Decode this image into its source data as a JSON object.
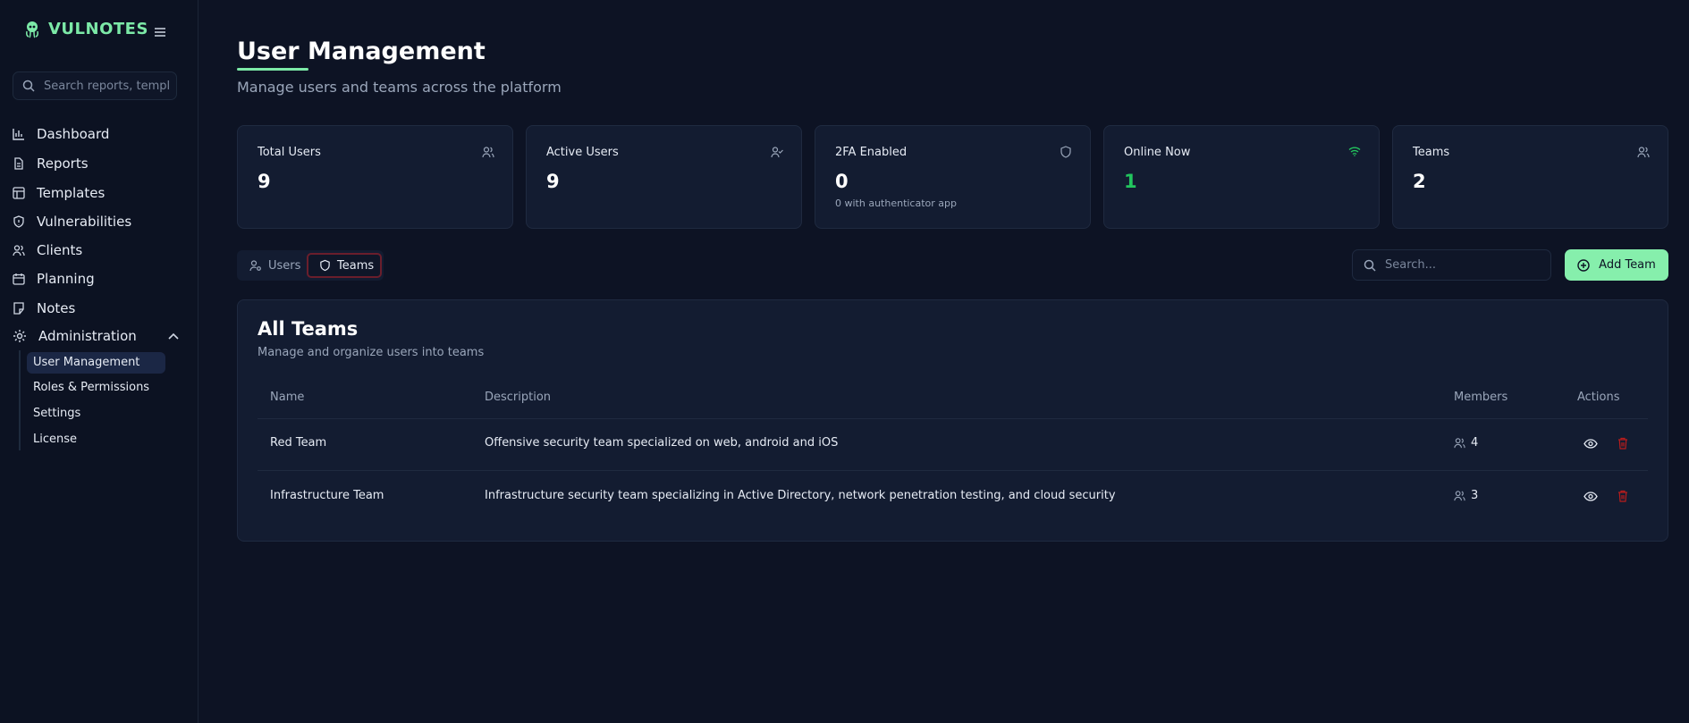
{
  "brand": {
    "name": "VULNOTES",
    "accent": "#7ce9a7"
  },
  "sidebar": {
    "search_placeholder": "Search reports, templates...",
    "items": [
      {
        "label": "Dashboard",
        "icon": "bar-chart-icon"
      },
      {
        "label": "Reports",
        "icon": "file-text-icon"
      },
      {
        "label": "Templates",
        "icon": "layout-icon"
      },
      {
        "label": "Vulnerabilities",
        "icon": "shield-alert-icon"
      },
      {
        "label": "Clients",
        "icon": "users-icon"
      },
      {
        "label": "Planning",
        "icon": "calendar-icon"
      },
      {
        "label": "Notes",
        "icon": "sticky-note-icon"
      }
    ],
    "admin": {
      "label": "Administration",
      "icon": "gear-icon",
      "subitems": [
        {
          "label": "User Management",
          "active": true
        },
        {
          "label": "Roles & Permissions"
        },
        {
          "label": "Settings"
        },
        {
          "label": "License"
        }
      ]
    }
  },
  "page": {
    "title": "User Management",
    "subtitle": "Manage users and teams across the platform"
  },
  "stats": [
    {
      "label": "Total Users",
      "value": "9",
      "icon": "users-icon"
    },
    {
      "label": "Active Users",
      "value": "9",
      "icon": "user-check-icon"
    },
    {
      "label": "2FA Enabled",
      "value": "0",
      "sub": "0 with authenticator app",
      "icon": "shield-icon"
    },
    {
      "label": "Online Now",
      "value": "1",
      "icon": "wifi-icon",
      "value_color": "#22c55e"
    },
    {
      "label": "Teams",
      "value": "2",
      "icon": "users-icon"
    }
  ],
  "tabs": [
    {
      "label": "Users",
      "icon": "user-cog-icon",
      "active": false
    },
    {
      "label": "Teams",
      "icon": "shield-icon",
      "active": true
    }
  ],
  "search": {
    "placeholder": "Search..."
  },
  "add_button": {
    "label": "Add Team",
    "icon": "plus-circle-icon",
    "color": "#86efac"
  },
  "teams_panel": {
    "title": "All Teams",
    "subtitle": "Manage and organize users into teams",
    "columns": [
      "Name",
      "Description",
      "Members",
      "Actions"
    ],
    "rows": [
      {
        "name": "Red Team",
        "description": "Offensive security team specialized on web, android and iOS",
        "members": "4"
      },
      {
        "name": "Infrastructure Team",
        "description": "Infrastructure security team specializing in Active Directory, network penetration testing, and cloud security",
        "members": "3"
      }
    ]
  },
  "colors": {
    "background": "#0d1324",
    "card": "#131c31",
    "danger": "#b91c1c",
    "online": "#22c55e"
  }
}
